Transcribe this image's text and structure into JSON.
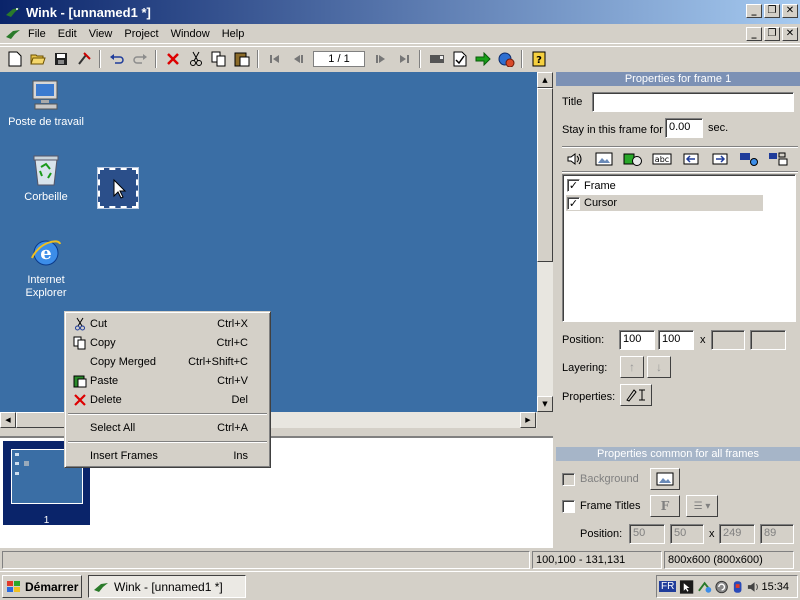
{
  "window": {
    "title": "Wink - [unnamed1 *]",
    "caption_buttons": [
      "minimize-icon",
      "restore-icon",
      "close-icon"
    ]
  },
  "menubar": {
    "items": [
      "File",
      "Edit",
      "View",
      "Project",
      "Window",
      "Help"
    ]
  },
  "toolbar": {
    "page_indicator": "1 / 1",
    "icons": [
      "new-icon",
      "open-icon",
      "save-icon",
      "render-icon",
      "undo-icon",
      "redo-icon",
      "delete-icon",
      "cut-icon",
      "copy-icon",
      "paste-icon",
      "first-frame-icon",
      "previous-frame-icon",
      "next-frame-icon",
      "last-frame-icon",
      "preview-frame-icon",
      "verify-icon",
      "export-icon",
      "browser-icon",
      "help-icon"
    ]
  },
  "desktop": {
    "icons": [
      {
        "label": "Poste de travail",
        "icon": "computer-icon"
      },
      {
        "label": "Corbeille",
        "icon": "recycle-bin-icon"
      },
      {
        "label": "Internet\nExplorer",
        "icon": "internet-explorer-icon"
      }
    ]
  },
  "context_menu": {
    "items": [
      {
        "label": "Cut",
        "shortcut": "Ctrl+X",
        "icon": "cut-icon"
      },
      {
        "label": "Copy",
        "shortcut": "Ctrl+C",
        "icon": "copy-icon"
      },
      {
        "label": "Copy Merged",
        "shortcut": "Ctrl+Shift+C",
        "icon": ""
      },
      {
        "label": "Paste",
        "shortcut": "Ctrl+V",
        "icon": "paste-icon"
      },
      {
        "label": "Delete",
        "shortcut": "Del",
        "icon": "delete-icon"
      },
      {
        "label": "Select All",
        "shortcut": "Ctrl+A",
        "icon": ""
      },
      {
        "label": "Insert Frames",
        "shortcut": "Ins",
        "icon": ""
      }
    ]
  },
  "frames_strip": {
    "frames": [
      {
        "number": "1"
      }
    ]
  },
  "frame_props": {
    "header": "Properties for frame 1",
    "title_label": "Title",
    "title_value": "",
    "stay_label": "Stay in this frame for",
    "stay_value": "0.00",
    "stay_unit": "sec.",
    "objects": [
      {
        "label": "Frame",
        "checked": true
      },
      {
        "label": "Cursor",
        "checked": true
      }
    ],
    "position_label": "Position:",
    "position_x": "100",
    "position_y": "100",
    "times_label": "x",
    "size_w": "",
    "size_h": "",
    "layering_label": "Layering:",
    "properties_label": "Properties:"
  },
  "common_props": {
    "header": "Properties common for all frames",
    "background_label": "Background",
    "frame_titles_label": "Frame Titles",
    "position_label": "Position:",
    "pos_x": "50",
    "pos_y": "50",
    "times_label": "x",
    "size_w": "249",
    "size_h": "89"
  },
  "statusbar": {
    "panes": [
      "",
      "100,100 - 131,131",
      "800x600 (800x600)"
    ]
  },
  "taskbar": {
    "start_label": "Démarrer",
    "task_label": "Wink - [unnamed1 *]",
    "lang": "FR",
    "clock": "15:34"
  },
  "colors": {
    "desktop": "#3a6ea5",
    "title_gradient_start": "#0a246a",
    "panel_header": "#a6b5c8"
  }
}
